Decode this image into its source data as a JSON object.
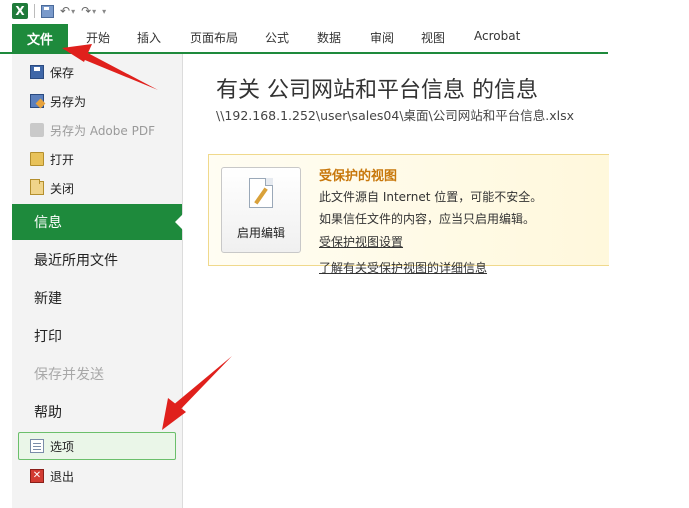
{
  "quick_access": {
    "logo": "X",
    "icons": [
      "excel-logo-icon",
      "save-icon",
      "undo-icon",
      "redo-icon",
      "customize-qat-icon"
    ]
  },
  "ribbon": {
    "tabs": [
      {
        "id": "file",
        "label": "文件"
      },
      {
        "id": "home",
        "label": "开始"
      },
      {
        "id": "insert",
        "label": "插入"
      },
      {
        "id": "layout",
        "label": "页面布局"
      },
      {
        "id": "formulas",
        "label": "公式"
      },
      {
        "id": "data",
        "label": "数据"
      },
      {
        "id": "review",
        "label": "审阅"
      },
      {
        "id": "view",
        "label": "视图"
      },
      {
        "id": "acrobat",
        "label": "Acrobat"
      }
    ],
    "active_tab": "file",
    "accent": "#1e8a3c"
  },
  "backstage": {
    "commands": [
      {
        "label": "保存",
        "icon": "save-icon",
        "enabled": true
      },
      {
        "label": "另存为",
        "icon": "save-as-icon",
        "enabled": true
      },
      {
        "label": "另存为 Adobe PDF",
        "icon": "pdf-icon",
        "enabled": false
      },
      {
        "label": "打开",
        "icon": "open-folder-icon",
        "enabled": true
      },
      {
        "label": "关闭",
        "icon": "close-folder-icon",
        "enabled": true
      }
    ],
    "nav": [
      {
        "label": "信息",
        "selected": true,
        "enabled": true
      },
      {
        "label": "最近所用文件",
        "enabled": true
      },
      {
        "label": "新建",
        "enabled": true
      },
      {
        "label": "打印",
        "enabled": true
      },
      {
        "label": "保存并发送",
        "enabled": false
      },
      {
        "label": "帮助",
        "enabled": true
      }
    ],
    "footer_commands": [
      {
        "label": "选项",
        "icon": "options-icon",
        "highlighted": true
      },
      {
        "label": "退出",
        "icon": "exit-icon"
      }
    ]
  },
  "info": {
    "title": "有关 公司网站和平台信息 的信息",
    "path": "\\\\192.168.1.252\\user\\sales04\\桌面\\公司网站和平台信息.xlsx"
  },
  "protected_view": {
    "button_label": "启用编辑",
    "heading": "受保护的视图",
    "line1": "此文件源自 Internet 位置，可能不安全。",
    "line2": "如果信任文件的内容，应当只启用编辑。",
    "link1": "受保护视图设置",
    "link2": "了解有关受保护视图的详细信息",
    "heading_color": "#c8780c"
  },
  "annotations": {
    "arrow_color": "#e0201c"
  }
}
